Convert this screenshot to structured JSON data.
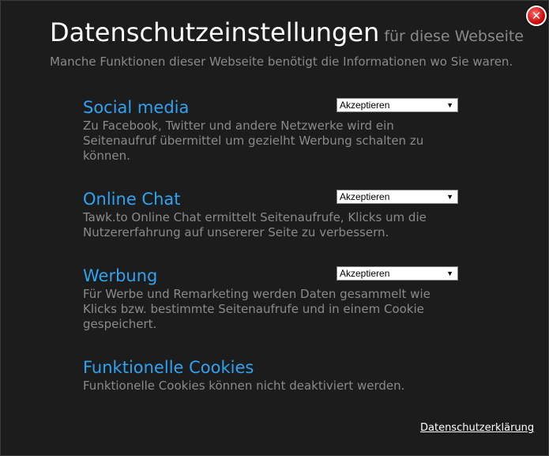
{
  "dialog": {
    "title": "Datenschutzeinstellungen",
    "subtitle": "für diese Webseite",
    "intro": "Manche Funktionen dieser Webseite benötigt die Informationen wo Sie waren.",
    "close_icon": "close-icon"
  },
  "sections": [
    {
      "title": "Social media",
      "text": "Zu Facebook, Twitter und andere Netzwerke wird ein Seitenaufruf übermittel um gezielht Werbung schalten zu können.",
      "select_value": "Akzeptieren"
    },
    {
      "title": "Online Chat",
      "text": "Tawk.to Online Chat ermittelt Seitenaufrufe, Klicks um die Nutzererfahrung auf unsererer Seite zu verbessern.",
      "select_value": "Akzeptieren"
    },
    {
      "title": "Werbung",
      "text": "Für Werbe und Remarketing werden Daten gesammelt wie Klicks bzw. bestimmte Seitenaufrufe und in einem Cookie gespeichert.",
      "select_value": "Akzeptieren"
    },
    {
      "title": "Funktionelle Cookies",
      "text": "Funktionelle Cookies können nicht deaktiviert werden."
    }
  ],
  "footer": {
    "privacy_link": "Datenschutzerklärung"
  },
  "colors": {
    "background": "#1c1c1c",
    "heading": "#2ea3f2",
    "muted": "#8a8a8a",
    "close": "#c40000"
  }
}
